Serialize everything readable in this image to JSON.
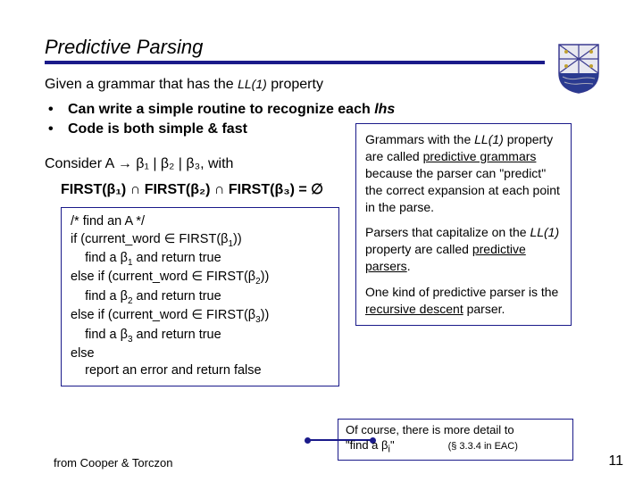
{
  "title": "Predictive Parsing",
  "intro_prefix": "Given a grammar that has the ",
  "intro_ll1": "LL(1)",
  "intro_suffix": " property",
  "bullet1_prefix": "Can write a simple routine to recognize each ",
  "bullet1_lhs": "lhs",
  "bullet2": "Code is both simple & fast",
  "consider_line": "Consider A → β₁ | β₂ | β₃, with",
  "first_line": "FIRST(β₁) ∩ FIRST(β₂) ∩ FIRST(β₃) = ∅",
  "code": {
    "l1": "/* find an A */",
    "l2a": "if (current_word ∈ ",
    "l2b": "FIRST",
    "l2c": "(β",
    "l2s": "1",
    "l2d": "))",
    "l3": "    find a β",
    "l3s": "1",
    "l3b": " and return true",
    "l4a": "else if (current_word ∈ ",
    "l4b": "FIRST",
    "l4c": "(β",
    "l4s": "2",
    "l4d": "))",
    "l5": "    find a β",
    "l5s": "2",
    "l5b": " and return true",
    "l6a": "else if (current_word ∈ ",
    "l6b": "FIRST",
    "l6c": "(β",
    "l6s": "3",
    "l6d": "))",
    "l7": "    find a β",
    "l7s": "3",
    "l7b": " and return true",
    "l8": "else",
    "l9": "    report an error and return false"
  },
  "right": {
    "p1a": "Grammars with the ",
    "p1ll": "LL(1)",
    "p1b": " property are called ",
    "p1u": "predictive grammars",
    "p1c": " because the parser can \"predict\" the correct expansion at each point in the parse.",
    "p2a": "Parsers that capitalize on the ",
    "p2ll": "LL(1)",
    "p2b": " property are called ",
    "p2u": "predictive parsers",
    "p2c": ".",
    "p3a": "One kind of predictive parser is the ",
    "p3u": "recursive descent",
    "p3b": " parser."
  },
  "note_line1": "Of course, there is more detail to",
  "note_line2a": "\"find a β",
  "note_line2s": "i",
  "note_line2b": "\"",
  "note_ref": "(§ 3.3.4 in EAC)",
  "footer": "from Cooper & Torczon",
  "page": "11"
}
